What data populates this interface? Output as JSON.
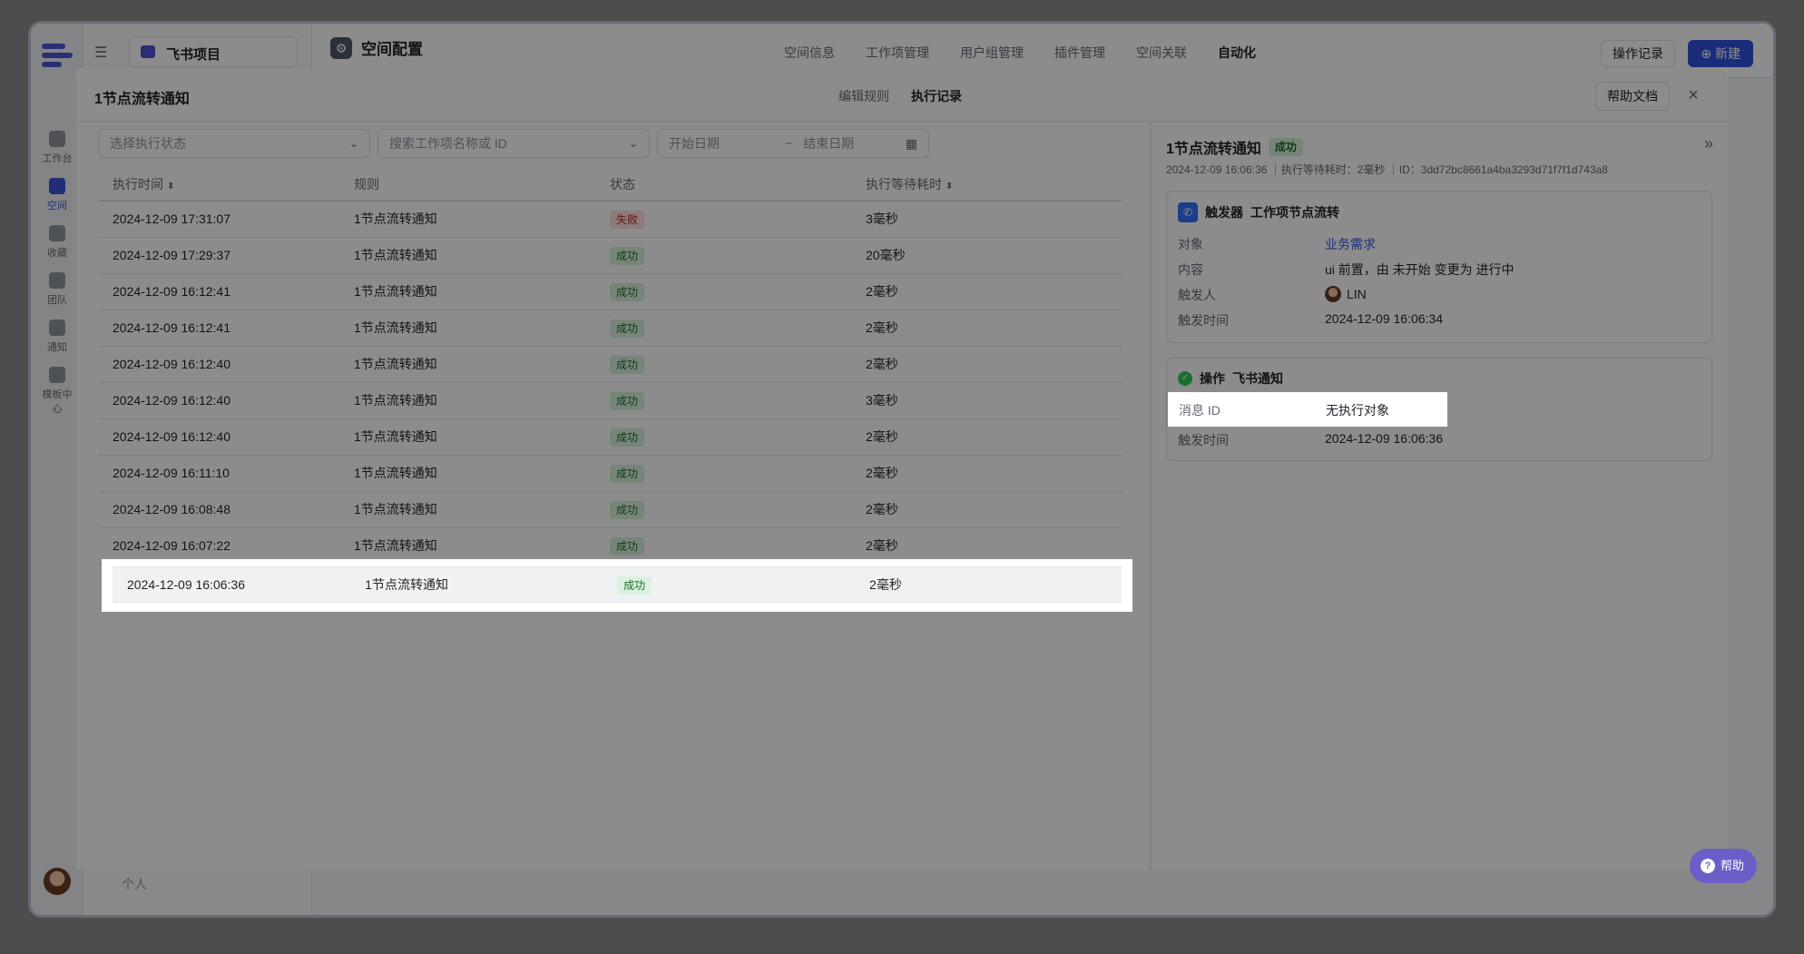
{
  "app": {
    "project_name": "飞书项目",
    "space_title": "空间配置",
    "top_tabs": [
      "空间信息",
      "工作项管理",
      "用户组管理",
      "插件管理",
      "空间关联",
      "自动化"
    ],
    "active_top_tab": "自动化",
    "oplog_button": "操作记录",
    "new_button": "新建",
    "personal_label": "个人",
    "nav_items": [
      "工作台",
      "空间",
      "收藏",
      "团队",
      "通知",
      "模板中心"
    ]
  },
  "modal": {
    "title": "1节点流转通知",
    "tabs": [
      "编辑规则",
      "执行记录"
    ],
    "active_tab": "执行记录",
    "help_doc_button": "帮助文档",
    "close_icon": "×",
    "filters": {
      "status_placeholder": "选择执行状态",
      "search_placeholder": "搜索工作项名称或 ID",
      "start_date_placeholder": "开始日期",
      "date_sep": "~",
      "end_date_placeholder": "结束日期"
    },
    "table": {
      "headers": {
        "time": "执行时间",
        "rule": "规则",
        "status": "状态",
        "duration": "执行等待耗时"
      },
      "rows": [
        {
          "time": "2024-12-09 17:31:07",
          "rule": "1节点流转通知",
          "status": "失败",
          "duration": "3毫秒"
        },
        {
          "time": "2024-12-09 17:29:37",
          "rule": "1节点流转通知",
          "status": "成功",
          "duration": "20毫秒"
        },
        {
          "time": "2024-12-09 16:12:41",
          "rule": "1节点流转通知",
          "status": "成功",
          "duration": "2毫秒"
        },
        {
          "time": "2024-12-09 16:12:41",
          "rule": "1节点流转通知",
          "status": "成功",
          "duration": "2毫秒"
        },
        {
          "time": "2024-12-09 16:12:40",
          "rule": "1节点流转通知",
          "status": "成功",
          "duration": "2毫秒"
        },
        {
          "time": "2024-12-09 16:12:40",
          "rule": "1节点流转通知",
          "status": "成功",
          "duration": "3毫秒"
        },
        {
          "time": "2024-12-09 16:12:40",
          "rule": "1节点流转通知",
          "status": "成功",
          "duration": "2毫秒"
        },
        {
          "time": "2024-12-09 16:11:10",
          "rule": "1节点流转通知",
          "status": "成功",
          "duration": "2毫秒"
        },
        {
          "time": "2024-12-09 16:08:48",
          "rule": "1节点流转通知",
          "status": "成功",
          "duration": "2毫秒"
        },
        {
          "time": "2024-12-09 16:07:22",
          "rule": "1节点流转通知",
          "status": "成功",
          "duration": "2毫秒"
        }
      ],
      "selected_row": {
        "time": "2024-12-09 16:06:36",
        "rule": "1节点流转通知",
        "status": "成功",
        "duration": "2毫秒"
      }
    },
    "detail": {
      "title": "1节点流转通知",
      "status": "成功",
      "meta": "2024-12-09 16:06:36 ｜执行等待耗时：2毫秒 ｜ID：3dd72bc8661a4ba3293d71f7f1d743a8",
      "trigger": {
        "label": "触发器",
        "name": "工作项节点流转",
        "object_label": "对象",
        "object_value": "业务需求",
        "content_label": "内容",
        "content_value": "ui 前置，由 未开始 变更为 进行中",
        "trigger_by_label": "触发人",
        "trigger_by_value": "LIN",
        "trigger_time_label": "触发时间",
        "trigger_time_value": "2024-12-09 16:06:34"
      },
      "operation": {
        "label": "操作",
        "name": "飞书通知",
        "msg_id_label": "消息 ID",
        "msg_id_value": "无执行对象",
        "trigger_time_label": "触发时间",
        "trigger_time_value": "2024-12-09 16:06:36"
      }
    },
    "help_button": "帮助"
  }
}
